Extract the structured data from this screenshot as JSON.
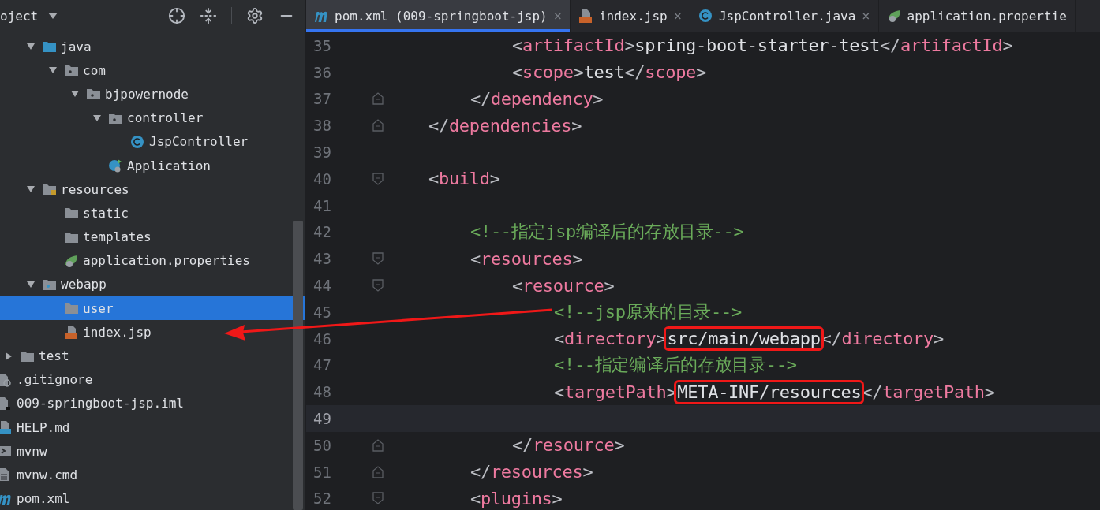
{
  "project_panel": {
    "title": "oject",
    "tree": [
      {
        "children": [
          {
            "children": [
              {
                "label": "java",
                "kind": "source-folder",
                "expanded": true,
                "selected": false,
                "children": [
                  {
                    "label": "com",
                    "kind": "package",
                    "expanded": true,
                    "selected": false,
                    "children": [
                      {
                        "label": "bjpowernode",
                        "kind": "package",
                        "expanded": true,
                        "selected": false,
                        "children": [
                          {
                            "label": "controller",
                            "kind": "package",
                            "expanded": true,
                            "selected": false,
                            "children": [
                              {
                                "label": "JspController",
                                "kind": "class",
                                "selected": false
                              }
                            ]
                          },
                          {
                            "label": "Application",
                            "kind": "spring-app",
                            "selected": false
                          }
                        ]
                      }
                    ]
                  }
                ]
              },
              {
                "label": "resources",
                "kind": "resources-folder",
                "expanded": true,
                "selected": false,
                "children": [
                  {
                    "label": "static",
                    "kind": "folder",
                    "selected": false
                  },
                  {
                    "label": "templates",
                    "kind": "folder",
                    "selected": false
                  },
                  {
                    "label": "application.properties",
                    "kind": "spring-properties",
                    "selected": false
                  }
                ]
              },
              {
                "label": "webapp",
                "kind": "web-folder",
                "expanded": true,
                "selected": false,
                "children": [
                  {
                    "label": "user",
                    "kind": "folder",
                    "selected": true
                  },
                  {
                    "label": "index.jsp",
                    "kind": "jsp",
                    "selected": false
                  }
                ]
              }
            ]
          },
          {
            "label": "test",
            "kind": "folder",
            "expanded": false,
            "selected": false
          }
        ]
      },
      {
        "label": ".gitignore",
        "kind": "ignore-file",
        "selected": false
      },
      {
        "label": "009-springboot-jsp.iml",
        "kind": "module-file",
        "selected": false
      },
      {
        "label": "HELP.md",
        "kind": "markdown",
        "selected": false
      },
      {
        "label": "mvnw",
        "kind": "shell",
        "selected": false
      },
      {
        "label": "mvnw.cmd",
        "kind": "text-file",
        "selected": false
      },
      {
        "label": "pom.xml",
        "kind": "maven",
        "selected": false
      }
    ]
  },
  "tabs": [
    {
      "label": "pom.xml (009-springboot-jsp)",
      "kind": "maven",
      "selected": true,
      "close": "×"
    },
    {
      "label": "index.jsp",
      "kind": "jsp",
      "selected": false,
      "close": "×"
    },
    {
      "label": "JspController.java",
      "kind": "class",
      "selected": false,
      "close": "×"
    },
    {
      "label": "application.propertie",
      "kind": "spring-properties",
      "selected": false
    }
  ],
  "editor": {
    "lines": [
      {
        "number": "35",
        "kind": "markup",
        "current": false,
        "text": "            <artifactId>spring-boot-starter-test</artifactId>"
      },
      {
        "number": "36",
        "kind": "markup",
        "current": false,
        "text": "            <scope>test</scope>"
      },
      {
        "number": "37",
        "kind": "markup",
        "fold": {
          "kind": "end"
        },
        "current": false,
        "text": "        </dependency>"
      },
      {
        "number": "38",
        "kind": "markup",
        "fold": {
          "kind": "end"
        },
        "current": false,
        "text": "    </dependencies>"
      },
      {
        "number": "39",
        "kind": "blank",
        "current": false
      },
      {
        "number": "40",
        "kind": "markup",
        "fold": {
          "kind": "start"
        },
        "current": false,
        "text": "    <build>"
      },
      {
        "number": "41",
        "kind": "blank",
        "current": false
      },
      {
        "number": "42",
        "kind": "comment",
        "current": false,
        "text": "        <!--指定jsp编译后的存放目录-->"
      },
      {
        "number": "43",
        "kind": "markup",
        "fold": {
          "kind": "start"
        },
        "current": false,
        "text": "        <resources>"
      },
      {
        "number": "44",
        "kind": "markup",
        "fold": {
          "kind": "start"
        },
        "current": false,
        "text": "            <resource>"
      },
      {
        "number": "45",
        "kind": "comment",
        "current": false,
        "text": "                <!--jsp原来的目录-->"
      },
      {
        "number": "46",
        "kind": "markup",
        "current": false,
        "value_boxed": true,
        "text": "                <directory>src/main/webapp</directory>"
      },
      {
        "number": "47",
        "kind": "comment",
        "current": false,
        "text": "                <!--指定编译后的存放目录-->"
      },
      {
        "number": "48",
        "kind": "markup",
        "current": false,
        "value_boxed": true,
        "text": "                <targetPath>META-INF/resources</targetPath>"
      },
      {
        "number": "49",
        "kind": "blank",
        "current": true
      },
      {
        "number": "50",
        "kind": "markup",
        "fold": {
          "kind": "end"
        },
        "current": false,
        "text": "            </resource>"
      },
      {
        "number": "51",
        "kind": "markup",
        "fold": {
          "kind": "end"
        },
        "current": false,
        "text": "        </resources>"
      },
      {
        "number": "52",
        "kind": "markup",
        "fold": {
          "kind": "start"
        },
        "current": false,
        "text": "        <plugins>"
      }
    ]
  },
  "annotations": [
    {
      "kind": "arrow"
    }
  ]
}
